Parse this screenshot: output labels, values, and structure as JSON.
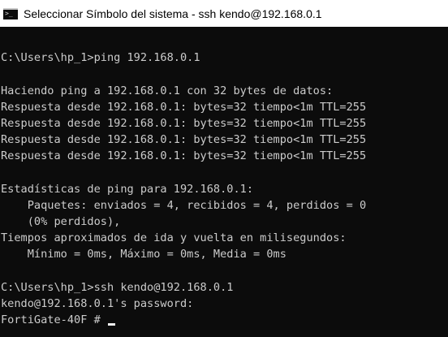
{
  "window": {
    "title": "Seleccionar Símbolo del sistema - ssh  kendo@192.168.0.1",
    "icon": "cmd-icon"
  },
  "console": {
    "lines": [
      "",
      "C:\\Users\\hp_1>ping 192.168.0.1",
      "",
      "Haciendo ping a 192.168.0.1 con 32 bytes de datos:",
      "Respuesta desde 192.168.0.1: bytes=32 tiempo<1m TTL=255",
      "Respuesta desde 192.168.0.1: bytes=32 tiempo<1m TTL=255",
      "Respuesta desde 192.168.0.1: bytes=32 tiempo<1m TTL=255",
      "Respuesta desde 192.168.0.1: bytes=32 tiempo<1m TTL=255",
      "",
      "Estadísticas de ping para 192.168.0.1:",
      "    Paquetes: enviados = 4, recibidos = 4, perdidos = 0",
      "    (0% perdidos),",
      "Tiempos aproximados de ida y vuelta en milisegundos:",
      "    Mínimo = 0ms, Máximo = 0ms, Media = 0ms",
      "",
      "C:\\Users\\hp_1>ssh kendo@192.168.0.1",
      "kendo@192.168.0.1's password:",
      "FortiGate-40F # "
    ],
    "text_color": "#cccccc",
    "background_color": "#0c0c0c"
  }
}
